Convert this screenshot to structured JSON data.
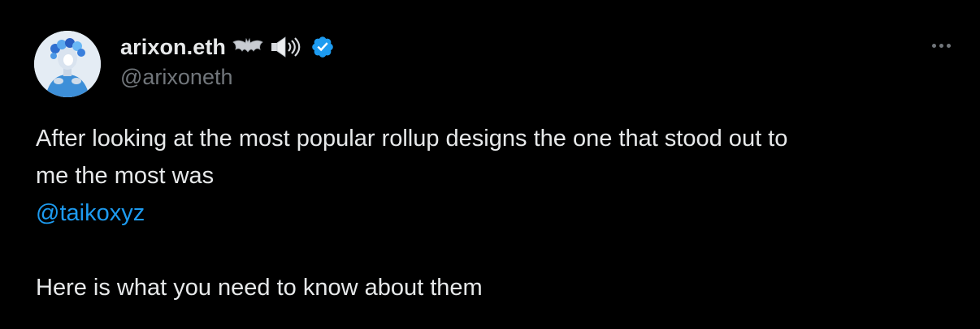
{
  "author": {
    "display_name": "arixon.eth",
    "emoji": [
      "bat-emoji",
      "speaker-emoji"
    ],
    "verified": true,
    "handle": "@arixoneth"
  },
  "more_menu": {
    "icon": "more-horizontal-icon"
  },
  "tweet": {
    "line1": "After looking at the most popular rollup designs the one that stood out to",
    "line2": "me the most was",
    "mention": "@taikoxyz",
    "line4": "Here is what you need to know about them"
  },
  "colors": {
    "background": "#000000",
    "text": "#e7e9ea",
    "secondary": "#71767b",
    "link": "#1d9bf0",
    "verified": "#1d9bf0"
  }
}
